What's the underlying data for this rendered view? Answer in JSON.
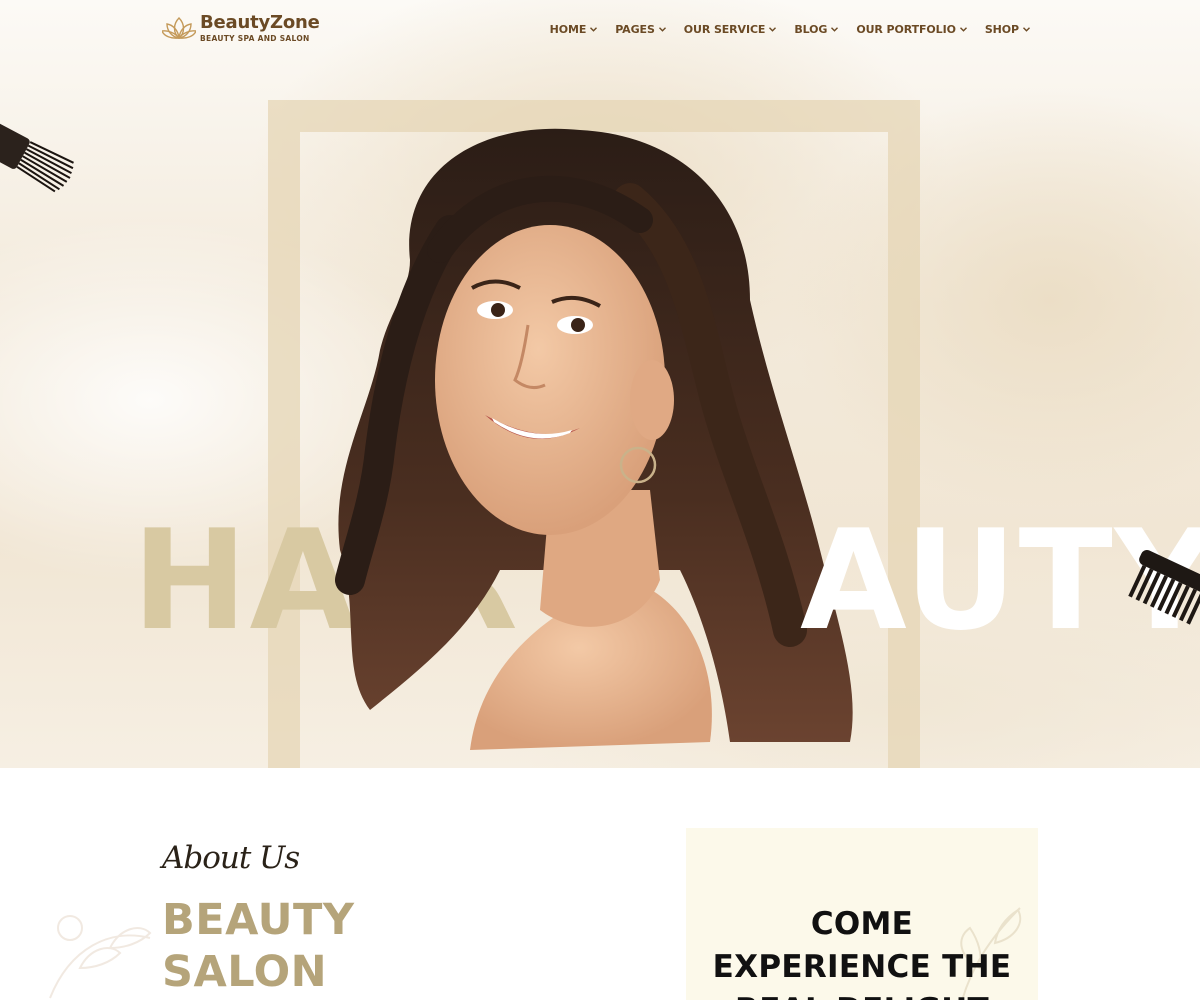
{
  "brand": {
    "name": "BeautyZone",
    "tagline": "BEAUTY SPA AND SALON"
  },
  "nav": {
    "items": [
      {
        "label": "HOME"
      },
      {
        "label": "PAGES"
      },
      {
        "label": "OUR SERVICE"
      },
      {
        "label": "BLOG"
      },
      {
        "label": "OUR PORTFOLIO"
      },
      {
        "label": "SHOP"
      }
    ]
  },
  "hero": {
    "word_left": "HAIR",
    "word_right": "AUTY"
  },
  "about": {
    "script_heading": "About Us",
    "title_line1": "BEAUTY",
    "title_line2": "SALON",
    "promo_line1": "COME",
    "promo_line2": "EXPERIENCE THE",
    "promo_line3": "REAL DELIGHT"
  },
  "colors": {
    "brand_brown": "#6b4a25",
    "accent_gold": "#b5a47a",
    "hero_tan": "#d8c9a2",
    "promo_bg": "#fcf9ea"
  },
  "icons": {
    "logo": "lotus-icon",
    "dropdown": "chevron-down-icon"
  }
}
